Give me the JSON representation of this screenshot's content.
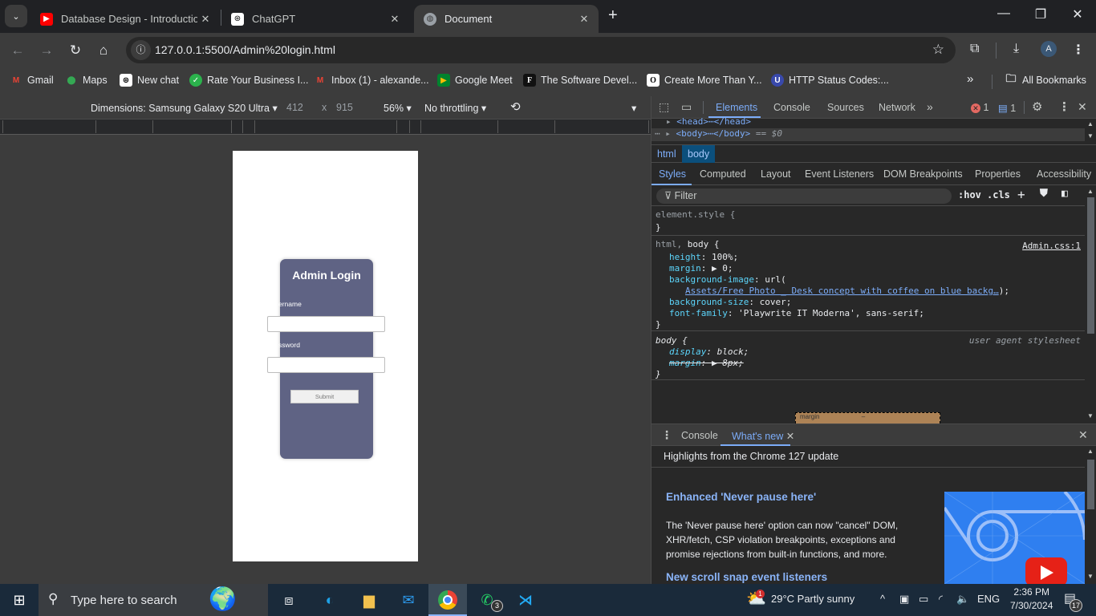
{
  "browser": {
    "tabs": [
      {
        "title": "Database Design - Introduction",
        "icon": "youtube-icon",
        "active": false
      },
      {
        "title": "ChatGPT",
        "icon": "chatgpt-icon",
        "active": false
      },
      {
        "title": "Document",
        "icon": "globe-icon",
        "active": true
      }
    ],
    "new_tab_label": "+",
    "url": "127.0.0.1:5500/Admin%20login.html",
    "profile_initial": "A",
    "bookmarks": [
      {
        "label": "Gmail",
        "icon": "gmail-icon"
      },
      {
        "label": "Maps",
        "icon": "maps-icon"
      },
      {
        "label": "New chat",
        "icon": "chatgpt-icon"
      },
      {
        "label": "Rate Your Business I...",
        "icon": "check-icon"
      },
      {
        "label": "Inbox (1) - alexande...",
        "icon": "gmail-icon"
      },
      {
        "label": "Google Meet",
        "icon": "meet-icon"
      },
      {
        "label": "The Software Devel...",
        "icon": "f-logo-icon"
      },
      {
        "label": "Create More Than Y...",
        "icon": "o-logo-icon"
      },
      {
        "label": "HTTP Status Codes:...",
        "icon": "u-logo-icon"
      }
    ],
    "bookmarks_overflow": "»",
    "all_bookmarks_label": "All Bookmarks"
  },
  "device_toolbar": {
    "dimensions_label": "Dimensions: Samsung Galaxy S20 Ultra",
    "width": "412",
    "times": "x",
    "height": "915",
    "zoom": "56%",
    "throttling": "No throttling"
  },
  "page": {
    "title": "Admin Login",
    "username_label": "ername",
    "password_label": "ssword",
    "username_value": "",
    "password_value": "",
    "submit_label": "Submit"
  },
  "devtools": {
    "tabs": [
      "Elements",
      "Console",
      "Sources",
      "Network"
    ],
    "more_tabs": "»",
    "error_count": "1",
    "message_count": "1",
    "dom": {
      "head_row": "<head>",
      "head_close": "</head>",
      "body_row": "<body>",
      "body_close": "</body>",
      "selected_suffix": "== $0"
    },
    "breadcrumbs": [
      "html",
      "body"
    ],
    "sub_tabs": [
      "Styles",
      "Computed",
      "Layout",
      "Event Listeners",
      "DOM Breakpoints",
      "Properties",
      "Accessibility"
    ],
    "filter_placeholder": "Filter",
    "hov_label": ":hov",
    "cls_label": ".cls",
    "styles": {
      "element_style_selector": "element.style {",
      "close_brace": "}",
      "rule1_selector_dim": "html,",
      "rule1_selector": "body {",
      "rule1_source": "Admin.css:1",
      "rule1_props": [
        {
          "name": "height",
          "value": "100%;"
        },
        {
          "name": "margin",
          "value": "▶ 0;"
        },
        {
          "name": "background-image",
          "value": "url("
        },
        {
          "name": "background-size",
          "value": "cover;"
        },
        {
          "name": "font-family",
          "value": "'Playwrite IT Moderna', sans-serif;"
        }
      ],
      "bg_url_link": "Assets/Free Photo _ Desk concept with coffee on blue backg…",
      "bg_url_close": ");",
      "rule2_selector": "body {",
      "rule2_source": "user agent stylesheet",
      "rule2_props": [
        {
          "name": "display",
          "value": "block;"
        },
        {
          "name": "margin",
          "value": "▶ 8px;"
        }
      ],
      "boxmodel_label": "margin",
      "boxmodel_value": "–"
    },
    "drawer": {
      "tabs": [
        "Console",
        "What's new"
      ],
      "whats_new": {
        "highlight": "Highlights from the Chrome 127 update",
        "heading1": "Enhanced 'Never pause here'",
        "body1": "The 'Never pause here' option can now \"cancel\" DOM, XHR/fetch, CSP violation breakpoints, exceptions and promise rejections from built-in functions, and more.",
        "heading2": "New scroll snap event listeners"
      }
    }
  },
  "taskbar": {
    "search_placeholder": "Type here to search",
    "whatsapp_badge": "3",
    "weather_badge": "1",
    "weather": "29°C  Partly sunny",
    "language": "ENG",
    "time": "2:36 PM",
    "date": "7/30/2024",
    "notification_count": "17"
  },
  "colors": {
    "card_bg": "#5f6384",
    "accent_blue": "#7cacf8",
    "css_property": "#5cd5fb"
  }
}
